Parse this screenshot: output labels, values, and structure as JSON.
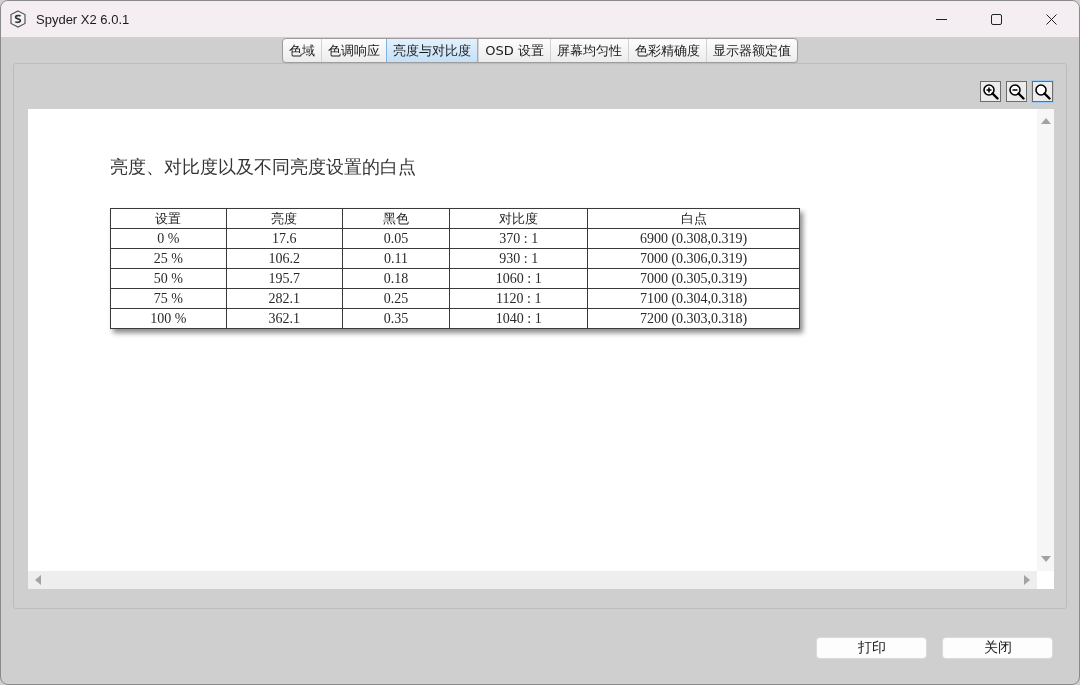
{
  "window": {
    "title": "Spyder X2 6.0.1"
  },
  "tabs": [
    {
      "label": "色域",
      "selected": false
    },
    {
      "label": "色调响应",
      "selected": false
    },
    {
      "label": "亮度与对比度",
      "selected": true
    },
    {
      "label": "OSD 设置",
      "selected": false
    },
    {
      "label": "屏幕均匀性",
      "selected": false
    },
    {
      "label": "色彩精确度",
      "selected": false
    },
    {
      "label": "显示器额定值",
      "selected": false
    }
  ],
  "zoom_tools": [
    {
      "kind": "zoom-in",
      "selected": false
    },
    {
      "kind": "zoom-out",
      "selected": false
    },
    {
      "kind": "zoom-reset",
      "selected": true
    }
  ],
  "report": {
    "title": "亮度、对比度以及不同亮度设置的白点",
    "table": {
      "columns": [
        "设置",
        "亮度",
        "黑色",
        "对比度",
        "白点"
      ],
      "rows": [
        [
          "0 %",
          "17.6",
          "0.05",
          "370 : 1",
          "6900 (0.308,0.319)"
        ],
        [
          "25 %",
          "106.2",
          "0.11",
          "930 : 1",
          "7000 (0.306,0.319)"
        ],
        [
          "50 %",
          "195.7",
          "0.18",
          "1060 : 1",
          "7000 (0.305,0.319)"
        ],
        [
          "75 %",
          "282.1",
          "0.25",
          "1120 : 1",
          "7100 (0.304,0.318)"
        ],
        [
          "100 %",
          "362.1",
          "0.35",
          "1040 : 1",
          "7200 (0.303,0.318)"
        ]
      ]
    }
  },
  "buttons": [
    "打印",
    "关闭"
  ]
}
